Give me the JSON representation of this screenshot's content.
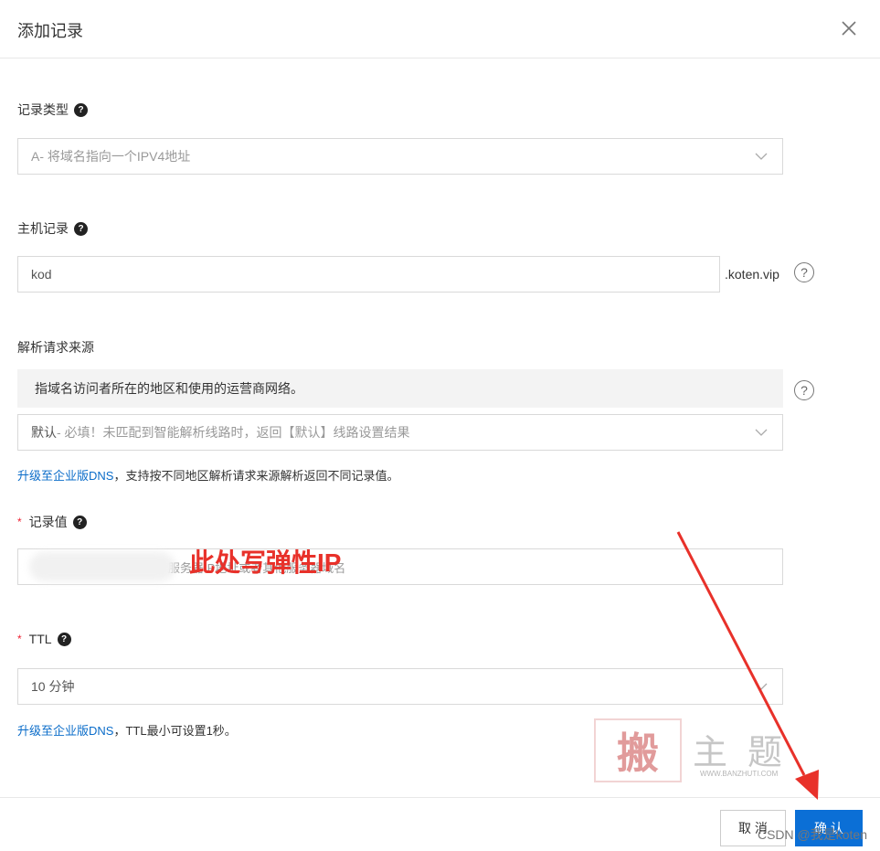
{
  "dialog": {
    "title": "添加记录"
  },
  "record_type": {
    "label": "记录类型",
    "value": "A- 将域名指向一个IPV4地址"
  },
  "host": {
    "label": "主机记录",
    "value": "kod",
    "suffix": ".koten.vip"
  },
  "source": {
    "label": "解析请求来源",
    "notice": "指域名访问者所在的地区和使用的运营商网络。",
    "value_strong": "默认",
    "value_rest": " - 必填！未匹配到智能解析线路时，返回【默认】线路设置结果",
    "upgrade_link": "升级至企业版DNS",
    "upgrade_rest": "，支持按不同地区解析请求来源解析返回不同记录值。"
  },
  "record_value": {
    "required_mark": "*",
    "label": "记录值",
    "placeholder": "服务器IP地址或者其他服务器域名"
  },
  "ttl": {
    "required_mark": "*",
    "label": "TTL",
    "value": "10 分钟",
    "upgrade_link": "升级至企业版DNS",
    "upgrade_rest": "，TTL最小可设置1秒。"
  },
  "annotation": "此处写弹性IP",
  "buttons": {
    "cancel": "取 消",
    "ok": "确 认"
  },
  "watermark": {
    "seal": "搬",
    "text": "主题",
    "url": "WWW.BANZHUTI.COM"
  },
  "credit": "CSDN @我是koten",
  "colors": {
    "primary": "#0b6fd6",
    "link": "#0a6cc9",
    "annotation": "#e8312a"
  },
  "icons": [
    "close-icon",
    "help-icon",
    "chevron-down-icon",
    "arrow-annotation"
  ]
}
